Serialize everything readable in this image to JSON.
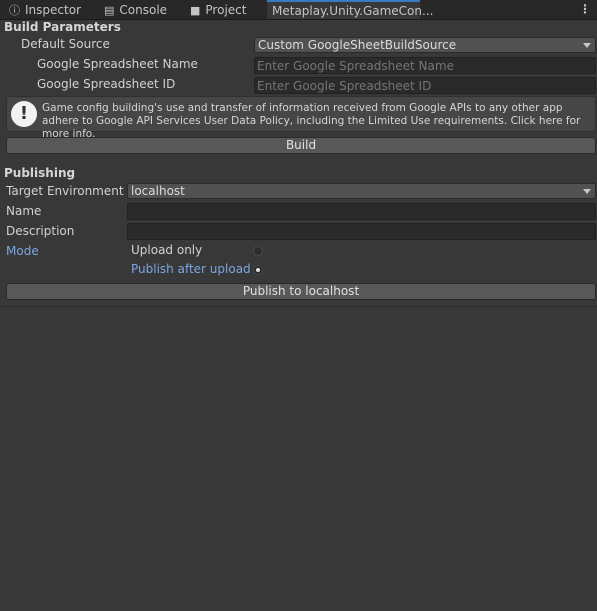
{
  "tabs": [
    {
      "label": "Inspector",
      "icon": "info-icon"
    },
    {
      "label": "Console",
      "icon": "console-icon"
    },
    {
      "label": "Project",
      "icon": "folder-icon"
    },
    {
      "label": "Metaplay.Unity.GameCon...",
      "icon": ""
    }
  ],
  "build": {
    "header": "Build Parameters",
    "default_source_label": "Default Source",
    "default_source_value": "Custom GoogleSheetBuildSource",
    "sheet_name_label": "Google Spreadsheet Name",
    "sheet_name_placeholder": "Enter Google Spreadsheet Name",
    "sheet_id_label": "Google Spreadsheet ID",
    "sheet_id_placeholder": "Enter Google Spreadsheet ID",
    "help_text": "Game config building's use and transfer of information received from Google APIs to any other app adhere to Google API Services User Data Policy, including the Limited Use requirements. Click here for more info.",
    "build_button": "Build"
  },
  "publishing": {
    "header": "Publishing",
    "target_env_label": "Target Environment",
    "target_env_value": "localhost",
    "name_label": "Name",
    "description_label": "Description",
    "mode_label": "Mode",
    "mode_options": [
      {
        "label": "Upload only",
        "selected": false
      },
      {
        "label": "Publish after upload",
        "selected": true
      }
    ],
    "publish_button": "Publish to localhost"
  },
  "colors": {
    "accent": "#3a79bb",
    "link": "#7ba6e0",
    "background": "#383838"
  }
}
